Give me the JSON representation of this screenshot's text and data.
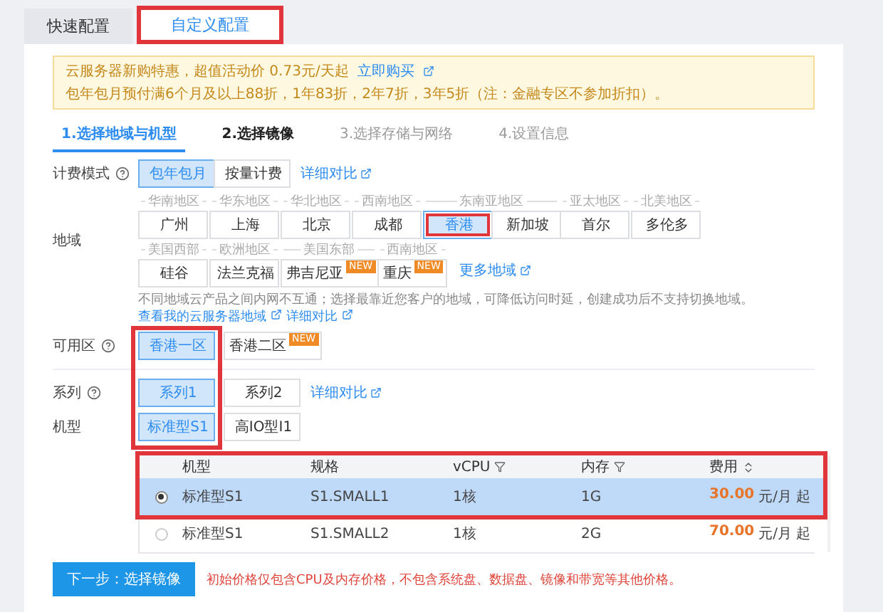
{
  "tabs": [
    {
      "label": "快速配置",
      "selected": false,
      "highlighted": false
    },
    {
      "label": "自定义配置",
      "selected": true,
      "highlighted": true
    }
  ],
  "notice": {
    "line1": "云服务器新购特惠，超值活动价 0.73元/天起",
    "link": "立即购买",
    "line2": "包年包月预付满6个月及以上88折，1年83折，2年7折，3年5折（注：金融专区不参加折扣）。"
  },
  "steps": [
    {
      "label": "1.选择地域与机型",
      "selected": true,
      "disabled": false
    },
    {
      "label": "2.选择镜像",
      "selected": false,
      "disabled": false
    },
    {
      "label": "3.选择存储与网络",
      "selected": false,
      "disabled": true
    },
    {
      "label": "4.设置信息",
      "selected": false,
      "disabled": true
    }
  ],
  "billing": {
    "label": "计费模式",
    "help": true,
    "options": [
      {
        "label": "包年包月",
        "selected": true
      },
      {
        "label": "按量计费",
        "selected": false
      }
    ],
    "link": "详细对比"
  },
  "region": {
    "label": "地域",
    "rows": [
      [
        {
          "area": "华南地区",
          "cities": [
            {
              "name": "广州",
              "selected": false,
              "highlighted": false
            }
          ]
        },
        {
          "area": "华东地区",
          "cities": [
            {
              "name": "上海",
              "selected": false,
              "highlighted": false
            }
          ]
        },
        {
          "area": "华北地区",
          "cities": [
            {
              "name": "北京",
              "selected": false,
              "highlighted": false
            }
          ]
        },
        {
          "area": "西南地区",
          "cities": [
            {
              "name": "成都",
              "selected": false,
              "highlighted": false
            }
          ]
        },
        {
          "area": "东南亚地区",
          "cities": [
            {
              "name": "香港",
              "selected": true,
              "highlighted": true
            },
            {
              "name": "新加坡",
              "selected": false,
              "highlighted": false
            }
          ]
        },
        {
          "area": "亚太地区",
          "cities": [
            {
              "name": "首尔",
              "selected": false,
              "highlighted": false
            }
          ]
        },
        {
          "area": "北美地区",
          "cities": [
            {
              "name": "多伦多",
              "selected": false,
              "highlighted": false
            }
          ]
        }
      ],
      [
        {
          "area": "美国西部",
          "cities": [
            {
              "name": "硅谷",
              "selected": false,
              "highlighted": false
            }
          ]
        },
        {
          "area": "欧洲地区",
          "cities": [
            {
              "name": "法兰克福",
              "selected": false,
              "highlighted": false
            }
          ]
        },
        {
          "area": "美国东部",
          "cities": [
            {
              "name": "弗吉尼亚",
              "selected": false,
              "highlighted": false,
              "badge": "NEW"
            }
          ]
        },
        {
          "area": "西南地区",
          "cities": [
            {
              "name": "重庆",
              "selected": false,
              "highlighted": false,
              "badge": "NEW"
            }
          ]
        }
      ]
    ],
    "more_link": "更多地域",
    "note": "不同地域云产品之间内网不互通；选择最靠近您客户的地域，可降低访问时延，创建成功后不支持切换地域。",
    "links": [
      "查看我的云服务器地域",
      "详细对比"
    ]
  },
  "first_options_highlighted": true,
  "zone": {
    "label": "可用区",
    "help": true,
    "options": [
      {
        "label": "香港一区",
        "selected": true
      },
      {
        "label": "香港二区",
        "selected": false,
        "badge": "NEW"
      }
    ]
  },
  "series": {
    "label": "系列",
    "help": true,
    "options": [
      {
        "label": "系列1",
        "selected": true
      },
      {
        "label": "系列2",
        "selected": false
      }
    ],
    "link": "详细对比"
  },
  "model": {
    "label": "机型",
    "options": [
      {
        "label": "标准型S1",
        "selected": true
      },
      {
        "label": "高IO型I1",
        "selected": false
      }
    ]
  },
  "table": {
    "columns": [
      {
        "label": "机型",
        "kind": "plain"
      },
      {
        "label": "规格",
        "kind": "plain"
      },
      {
        "label": "vCPU",
        "kind": "filter"
      },
      {
        "label": "内存",
        "kind": "filter"
      },
      {
        "label": "费用",
        "kind": "sort"
      }
    ],
    "rows": [
      {
        "selected": true,
        "highlighted": true,
        "cells": [
          "标准型S1",
          "S1.SMALL1",
          "1核",
          "1G"
        ],
        "price": "30.00",
        "unit": "元/月 起"
      },
      {
        "selected": false,
        "highlighted": false,
        "cells": [
          "标准型S1",
          "S1.SMALL2",
          "1核",
          "2G"
        ],
        "price": "70.00",
        "unit": "元/月 起"
      }
    ]
  },
  "footer": {
    "button": "下一步：选择镜像",
    "note": "初始价格仅包含CPU及内存价格，不包含系统盘、数据盘、镜像和带宽等其他价格。"
  }
}
